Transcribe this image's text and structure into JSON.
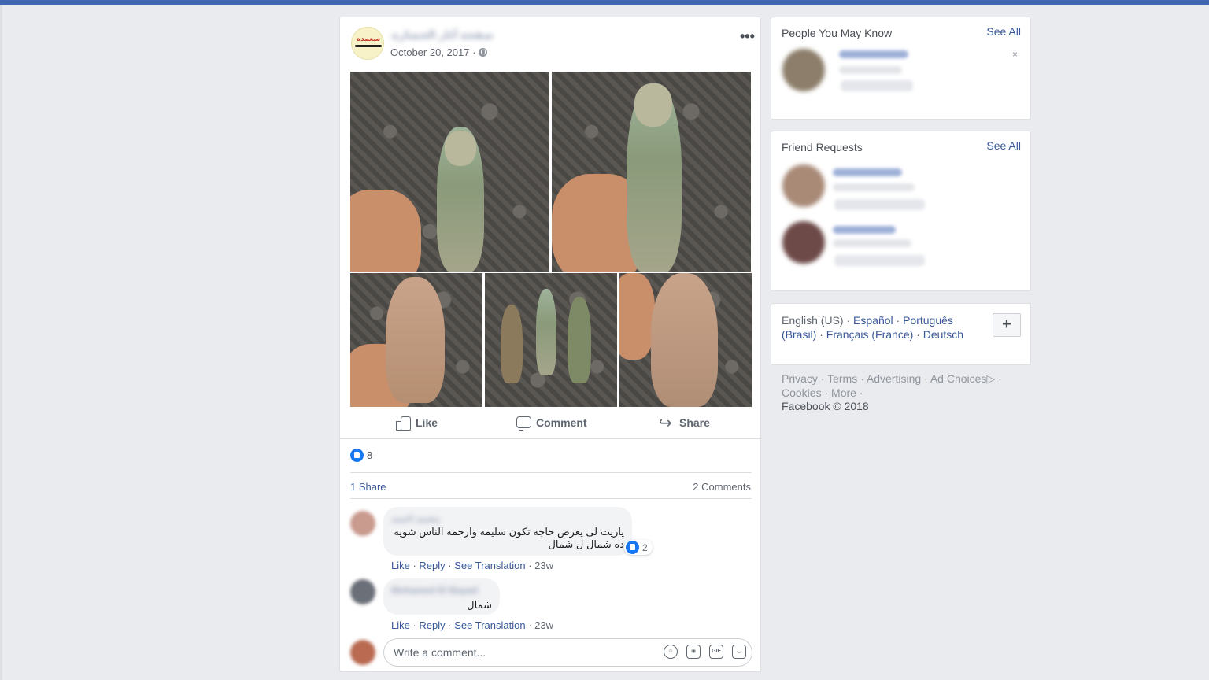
{
  "post": {
    "author_name": "صفحة آثار الحضارة",
    "avatar_logo_text": "سعمده",
    "date": "October 20, 2017 ·",
    "actions": {
      "like": "Like",
      "comment": "Comment",
      "share": "Share"
    },
    "reaction_count": "8",
    "share_count": "1 Share",
    "comment_count": "2 Comments",
    "comments": [
      {
        "author": "محمد احمد",
        "text": "ياريت لى يعرض حاجه تكون سليمه وارحمه الناس شويه ده شمال ل شمال",
        "reaction_count": "2",
        "meta": {
          "like": "Like",
          "reply": "Reply",
          "translate": "See Translation",
          "time": "23w"
        }
      },
      {
        "author": "Mohamed El Bayad",
        "text": "شمال",
        "meta": {
          "like": "Like",
          "reply": "Reply",
          "translate": "See Translation",
          "time": "23w"
        }
      }
    ],
    "write_placeholder": "Write a comment...",
    "write_tools": [
      "emoji-icon",
      "camera-icon",
      "gif-icon",
      "sticker-icon"
    ],
    "gif_label": "GIF"
  },
  "people_you_may_know": {
    "title": "People You May Know",
    "see_all": "See All",
    "close": "×"
  },
  "friend_requests": {
    "title": "Friend Requests",
    "see_all": "See All"
  },
  "languages": {
    "current": "English (US) · ",
    "items": [
      "Español",
      "Português (Brasil)",
      "Français (France)",
      "Deutsch"
    ],
    "sep": " · ",
    "plus": "+"
  },
  "footer": {
    "links": [
      "Privacy",
      "Terms",
      "Advertising",
      "Ad Choices▷",
      "Cookies",
      "More"
    ],
    "copyright": "Facebook © 2018"
  },
  "colors": {
    "topbar": "#4267b2",
    "link": "#385898",
    "like_blue": "#1877f2",
    "background": "#e9ebee"
  }
}
